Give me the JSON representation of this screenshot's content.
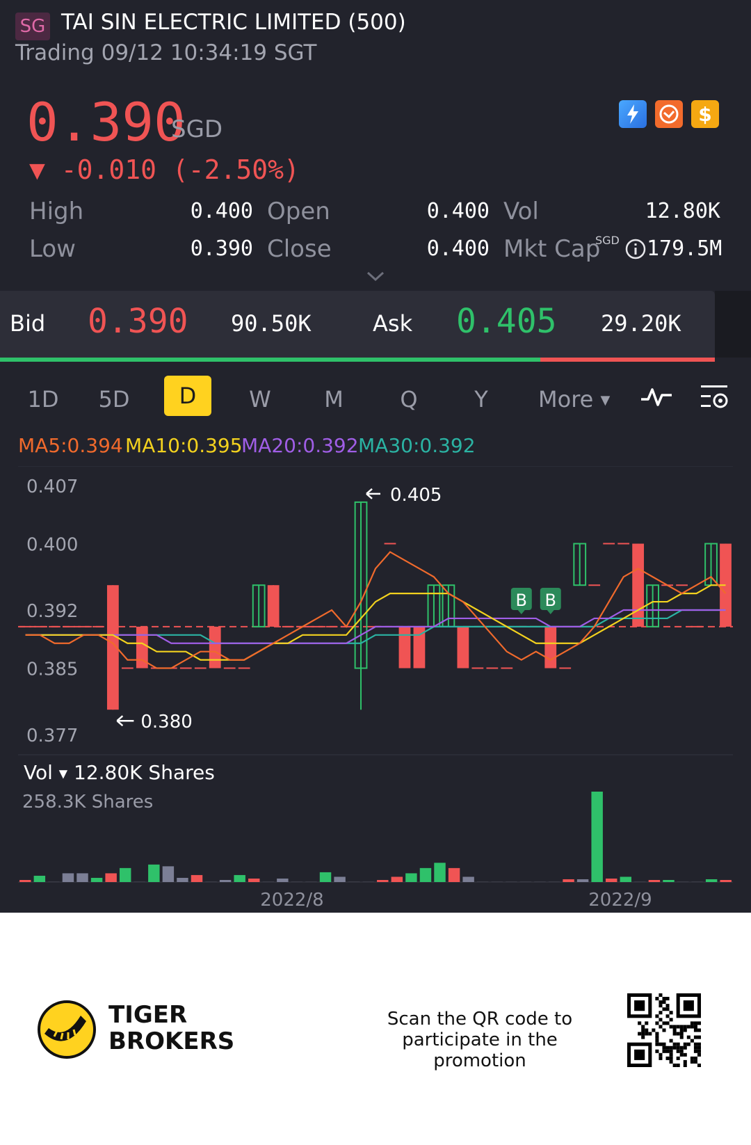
{
  "header": {
    "market_badge": "SG",
    "title": "TAI SIN ELECTRIC LIMITED (500)",
    "status": "Trading 09/12 10:34:19 SGT"
  },
  "quote": {
    "price": "0.390",
    "currency": "SGD",
    "change": "▼ -0.010 (-2.50%)",
    "icons": [
      "lightning-icon",
      "swap-icon",
      "dollar-icon"
    ],
    "stats": {
      "high_label": "High",
      "high": "0.400",
      "low_label": "Low",
      "low": "0.390",
      "open_label": "Open",
      "open": "0.400",
      "close_label": "Close",
      "close": "0.400",
      "vol_label": "Vol",
      "vol": "12.80K",
      "mktcap_label": "Mkt Cap",
      "mktcap_currency": "SGD",
      "mktcap": "179.5M"
    }
  },
  "bid_ask": {
    "bid_label": "Bid",
    "bid_price": "0.390",
    "bid_qty": "90.50K",
    "ask_label": "Ask",
    "ask_price": "0.405",
    "ask_qty": "29.20K",
    "bid_ratio": 0.756
  },
  "tabs": {
    "items": [
      "1D",
      "5D",
      "D",
      "W",
      "M",
      "Q",
      "Y"
    ],
    "active": "D",
    "more_label": "More"
  },
  "indicators": {
    "ma5": "MA5:0.394",
    "ma10": "MA10:0.395",
    "ma20": "MA20:0.392",
    "ma30": "MA30:0.392"
  },
  "colors": {
    "up": "#2fc16a",
    "down": "#f05454",
    "ma5": "#f06a2c",
    "ma10": "#f3d21e",
    "ma20": "#a05ee6",
    "ma30": "#2bb3a3",
    "accent": "#ffd21f"
  },
  "chart_data": {
    "type": "candlestick",
    "y_ticks": [
      "0.407",
      "0.400",
      "0.392",
      "0.385",
      "0.377"
    ],
    "ylim": [
      0.377,
      0.407
    ],
    "high_marker": "0.405",
    "low_marker": "0.380",
    "current_price": 0.39,
    "trade_markers": [
      "B",
      "B"
    ],
    "candles": [
      {
        "o": 0.39,
        "h": 0.39,
        "l": 0.39,
        "c": 0.39
      },
      {
        "o": 0.39,
        "h": 0.39,
        "l": 0.39,
        "c": 0.39
      },
      {
        "o": 0.39,
        "h": 0.39,
        "l": 0.39,
        "c": 0.39
      },
      {
        "o": 0.39,
        "h": 0.39,
        "l": 0.39,
        "c": 0.39
      },
      {
        "o": 0.39,
        "h": 0.39,
        "l": 0.39,
        "c": 0.39
      },
      {
        "o": 0.39,
        "h": 0.39,
        "l": 0.39,
        "c": 0.39
      },
      {
        "o": 0.395,
        "h": 0.395,
        "l": 0.38,
        "c": 0.38
      },
      {
        "o": 0.385,
        "h": 0.385,
        "l": 0.385,
        "c": 0.385
      },
      {
        "o": 0.39,
        "h": 0.39,
        "l": 0.385,
        "c": 0.385
      },
      {
        "o": 0.385,
        "h": 0.385,
        "l": 0.385,
        "c": 0.385
      },
      {
        "o": 0.385,
        "h": 0.385,
        "l": 0.385,
        "c": 0.385
      },
      {
        "o": 0.385,
        "h": 0.385,
        "l": 0.385,
        "c": 0.385
      },
      {
        "o": 0.385,
        "h": 0.385,
        "l": 0.385,
        "c": 0.385
      },
      {
        "o": 0.39,
        "h": 0.39,
        "l": 0.385,
        "c": 0.385
      },
      {
        "o": 0.385,
        "h": 0.385,
        "l": 0.385,
        "c": 0.385
      },
      {
        "o": 0.385,
        "h": 0.385,
        "l": 0.385,
        "c": 0.385
      },
      {
        "o": 0.39,
        "h": 0.395,
        "l": 0.39,
        "c": 0.395
      },
      {
        "o": 0.395,
        "h": 0.395,
        "l": 0.39,
        "c": 0.39
      },
      {
        "o": 0.39,
        "h": 0.39,
        "l": 0.39,
        "c": 0.39
      },
      {
        "o": 0.39,
        "h": 0.39,
        "l": 0.39,
        "c": 0.39
      },
      {
        "o": 0.39,
        "h": 0.39,
        "l": 0.39,
        "c": 0.39
      },
      {
        "o": 0.39,
        "h": 0.39,
        "l": 0.39,
        "c": 0.39
      },
      {
        "o": 0.39,
        "h": 0.39,
        "l": 0.39,
        "c": 0.39
      },
      {
        "o": 0.385,
        "h": 0.405,
        "l": 0.38,
        "c": 0.405
      },
      {
        "o": 0.39,
        "h": 0.39,
        "l": 0.39,
        "c": 0.39
      },
      {
        "o": 0.4,
        "h": 0.4,
        "l": 0.4,
        "c": 0.4
      },
      {
        "o": 0.39,
        "h": 0.39,
        "l": 0.385,
        "c": 0.385
      },
      {
        "o": 0.39,
        "h": 0.39,
        "l": 0.385,
        "c": 0.385
      },
      {
        "o": 0.39,
        "h": 0.395,
        "l": 0.39,
        "c": 0.395
      },
      {
        "o": 0.39,
        "h": 0.395,
        "l": 0.39,
        "c": 0.395
      },
      {
        "o": 0.39,
        "h": 0.39,
        "l": 0.385,
        "c": 0.385
      },
      {
        "o": 0.385,
        "h": 0.385,
        "l": 0.385,
        "c": 0.385
      },
      {
        "o": 0.385,
        "h": 0.385,
        "l": 0.385,
        "c": 0.385
      },
      {
        "o": 0.385,
        "h": 0.385,
        "l": 0.385,
        "c": 0.385
      },
      {
        "o": 0.39,
        "h": 0.39,
        "l": 0.39,
        "c": 0.39
      },
      {
        "o": 0.39,
        "h": 0.39,
        "l": 0.39,
        "c": 0.39
      },
      {
        "o": 0.39,
        "h": 0.39,
        "l": 0.385,
        "c": 0.385
      },
      {
        "o": 0.385,
        "h": 0.385,
        "l": 0.385,
        "c": 0.385
      },
      {
        "o": 0.395,
        "h": 0.4,
        "l": 0.395,
        "c": 0.4
      },
      {
        "o": 0.395,
        "h": 0.395,
        "l": 0.395,
        "c": 0.395
      },
      {
        "o": 0.4,
        "h": 0.4,
        "l": 0.4,
        "c": 0.4
      },
      {
        "o": 0.4,
        "h": 0.4,
        "l": 0.4,
        "c": 0.4
      },
      {
        "o": 0.4,
        "h": 0.4,
        "l": 0.39,
        "c": 0.39
      },
      {
        "o": 0.39,
        "h": 0.395,
        "l": 0.39,
        "c": 0.395
      },
      {
        "o": 0.395,
        "h": 0.395,
        "l": 0.395,
        "c": 0.395
      },
      {
        "o": 0.395,
        "h": 0.395,
        "l": 0.395,
        "c": 0.395
      },
      {
        "o": 0.39,
        "h": 0.39,
        "l": 0.39,
        "c": 0.39
      },
      {
        "o": 0.395,
        "h": 0.4,
        "l": 0.395,
        "c": 0.4
      },
      {
        "o": 0.4,
        "h": 0.4,
        "l": 0.39,
        "c": 0.39
      }
    ],
    "ma5": [
      0.389,
      0.389,
      0.388,
      0.388,
      0.389,
      0.389,
      0.388,
      0.386,
      0.386,
      0.385,
      0.385,
      0.386,
      0.387,
      0.387,
      0.386,
      0.386,
      0.387,
      0.388,
      0.389,
      0.39,
      0.391,
      0.392,
      0.39,
      0.393,
      0.397,
      0.399,
      0.398,
      0.397,
      0.396,
      0.394,
      0.393,
      0.391,
      0.389,
      0.387,
      0.386,
      0.387,
      0.386,
      0.387,
      0.388,
      0.39,
      0.393,
      0.396,
      0.397,
      0.396,
      0.395,
      0.394,
      0.395,
      0.396,
      0.394
    ],
    "ma10": [
      0.389,
      0.389,
      0.389,
      0.389,
      0.389,
      0.389,
      0.389,
      0.388,
      0.388,
      0.387,
      0.387,
      0.387,
      0.386,
      0.386,
      0.386,
      0.386,
      0.387,
      0.388,
      0.388,
      0.389,
      0.389,
      0.389,
      0.389,
      0.391,
      0.393,
      0.394,
      0.394,
      0.394,
      0.394,
      0.394,
      0.393,
      0.392,
      0.391,
      0.39,
      0.389,
      0.388,
      0.388,
      0.388,
      0.388,
      0.389,
      0.39,
      0.391,
      0.392,
      0.393,
      0.393,
      0.394,
      0.394,
      0.395,
      0.395
    ],
    "ma20": [
      0.389,
      0.389,
      0.389,
      0.389,
      0.389,
      0.389,
      0.389,
      0.389,
      0.389,
      0.389,
      0.388,
      0.388,
      0.388,
      0.388,
      0.388,
      0.388,
      0.388,
      0.388,
      0.388,
      0.388,
      0.388,
      0.388,
      0.388,
      0.389,
      0.39,
      0.39,
      0.39,
      0.39,
      0.39,
      0.391,
      0.391,
      0.391,
      0.391,
      0.391,
      0.391,
      0.391,
      0.39,
      0.39,
      0.39,
      0.391,
      0.391,
      0.392,
      0.392,
      0.392,
      0.392,
      0.392,
      0.392,
      0.392,
      0.392
    ],
    "ma30": [
      0.389,
      0.389,
      0.389,
      0.389,
      0.389,
      0.389,
      0.389,
      0.389,
      0.389,
      0.389,
      0.389,
      0.389,
      0.389,
      0.388,
      0.388,
      0.388,
      0.388,
      0.388,
      0.388,
      0.388,
      0.388,
      0.388,
      0.388,
      0.388,
      0.389,
      0.389,
      0.389,
      0.389,
      0.39,
      0.39,
      0.39,
      0.39,
      0.39,
      0.39,
      0.39,
      0.39,
      0.39,
      0.39,
      0.39,
      0.39,
      0.391,
      0.391,
      0.391,
      0.391,
      0.391,
      0.392,
      0.392,
      0.392,
      0.392
    ]
  },
  "volume": {
    "label": "Vol",
    "current": "12.80K Shares",
    "max_label": "258.3K Shares",
    "max_value": 258.3,
    "values": [
      2,
      18,
      0,
      25,
      25,
      12,
      25,
      40,
      0,
      50,
      45,
      12,
      20,
      0,
      5,
      20,
      10,
      0,
      10,
      0,
      0,
      28,
      15,
      0,
      0,
      5,
      15,
      25,
      40,
      55,
      40,
      15,
      0,
      0,
      0,
      0,
      0,
      0,
      8,
      8,
      258.3,
      10,
      15,
      0,
      5,
      2,
      0,
      0,
      8,
      5
    ],
    "dir": [
      "d",
      "u",
      "n",
      "g",
      "g",
      "u",
      "d",
      "u",
      "n",
      "u",
      "g",
      "g",
      "d",
      "n",
      "g",
      "u",
      "d",
      "n",
      "g",
      "n",
      "n",
      "u",
      "g",
      "n",
      "n",
      "d",
      "d",
      "u",
      "u",
      "u",
      "d",
      "g",
      "n",
      "n",
      "n",
      "n",
      "n",
      "n",
      "d",
      "g",
      "u",
      "d",
      "u",
      "n",
      "d",
      "u",
      "n",
      "n",
      "u",
      "d"
    ],
    "x_labels": [
      "2022/8",
      "2022/9"
    ]
  },
  "footer": {
    "brand_line1": "TIGER",
    "brand_line2": "BROKERS",
    "promo_line1": "Scan the QR code to",
    "promo_line2": "participate in the promotion"
  }
}
